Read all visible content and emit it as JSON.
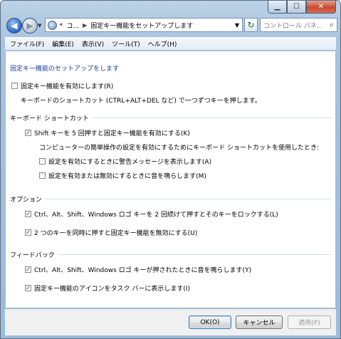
{
  "nav": {
    "back": "◀",
    "forward": "▶",
    "address": {
      "overflow": "«",
      "segment1": "コ...",
      "segment2": "固定キー機能をセットアップします"
    },
    "search_placeholder": "コントロール パネ..."
  },
  "menu": [
    "ファイル(F)",
    "編集(E)",
    "表示(V)",
    "ツール(T)",
    "ヘルプ(H)"
  ],
  "content": {
    "heading": "固定キー機能のセットアップをします",
    "main_checkbox": {
      "label": "固定キー機能を有効にします(R)",
      "checked": false
    },
    "main_desc": "キーボードのショートカット (CTRL+ALT+DEL など) で一つずつキーを押します。",
    "keyboard_section": {
      "title": "キーボード ショートカット",
      "shift5": {
        "label": "Shift キーを 5 回押すと固定キー機能を有効にする(K)",
        "checked": true
      },
      "note": "コンピューターの簡単操作の設定を有効にするためにキーボード ショートカットを使用したとき:",
      "warn": {
        "label": "設定を有効にするときに警告メッセージを表示します(A)",
        "checked": false
      },
      "sound": {
        "label": "設定を有効または無効にするときに音を鳴らします(M)",
        "checked": false
      }
    },
    "options_section": {
      "title": "オプション",
      "lock": {
        "label": "Ctrl、Alt、Shift、Windows ロゴ キーを 2 回続けて押すとそのキーをロックする(L)",
        "checked": true
      },
      "twokeys": {
        "label": "2 つのキーを同時に押すと固定キー機能を無効にする(U)",
        "checked": true
      }
    },
    "feedback_section": {
      "title": "フィードバック",
      "beep": {
        "label": "Ctrl、Alt、Shift、Windows ロゴ キーが押されたときに音を鳴らします(Y)",
        "checked": true
      },
      "taskbar": {
        "label": "固定キー機能のアイコンをタスク バーに表示します(I)",
        "checked": true
      }
    }
  },
  "buttons": {
    "ok": "OK(O)",
    "cancel": "キャンセル",
    "apply": "適用(P)"
  },
  "check_glyph": "✓"
}
